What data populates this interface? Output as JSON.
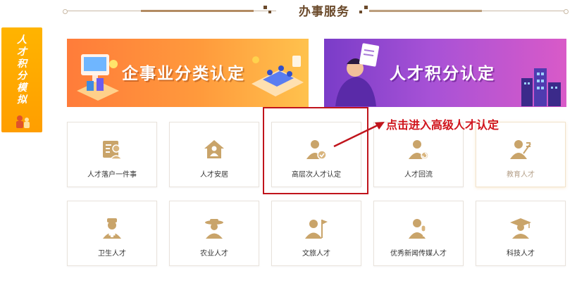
{
  "section": {
    "title": "办事服务"
  },
  "side_widget": {
    "text": "人才积分模拟"
  },
  "banners": [
    {
      "title": "企事业分类认定",
      "theme": "orange"
    },
    {
      "title": "人才积分认定",
      "theme": "purple"
    }
  ],
  "annotation": {
    "text": "点击进入高级人才认定",
    "color": "#d0141c"
  },
  "cards_row1": [
    {
      "label": "人才落户一件事",
      "icon": "id-card-person-icon"
    },
    {
      "label": "人才安居",
      "icon": "house-person-icon"
    },
    {
      "label": "高层次人才认定",
      "icon": "person-badge-icon"
    },
    {
      "label": "人才回流",
      "icon": "person-return-icon"
    },
    {
      "label": "教育人才",
      "icon": "teacher-icon"
    }
  ],
  "cards_row2": [
    {
      "label": "卫生人才",
      "icon": "doctor-icon"
    },
    {
      "label": "农业人才",
      "icon": "farmer-icon"
    },
    {
      "label": "文旅人才",
      "icon": "flag-person-icon"
    },
    {
      "label": "优秀新闻传媒人才",
      "icon": "microphone-person-icon"
    },
    {
      "label": "科技人才",
      "icon": "graduate-icon"
    }
  ],
  "colors": {
    "icon_gold": "#c9a46a",
    "title_brown": "#6b4a2b"
  }
}
